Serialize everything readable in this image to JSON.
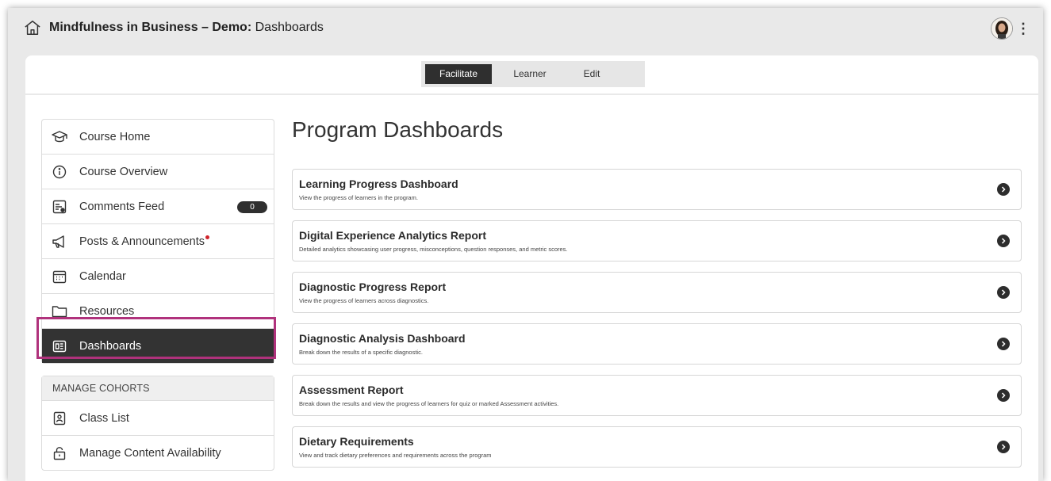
{
  "header": {
    "title_bold": "Mindfulness in Business – Demo:",
    "title_rest": "Dashboards",
    "icons": {
      "home": "home-icon",
      "avatar": "user-avatar",
      "menu": "kebab-menu-icon"
    }
  },
  "tabs": [
    {
      "label": "Facilitate",
      "active": true
    },
    {
      "label": "Learner",
      "active": false
    },
    {
      "label": "Edit",
      "active": false
    }
  ],
  "sidebar": {
    "items": [
      {
        "label": "Course Home",
        "icon": "graduation-cap-icon"
      },
      {
        "label": "Course Overview",
        "icon": "info-icon"
      },
      {
        "label": "Comments Feed",
        "icon": "comments-feed-icon",
        "badge": "0"
      },
      {
        "label": "Posts & Announcements",
        "icon": "megaphone-icon",
        "notification": true
      },
      {
        "label": "Calendar",
        "icon": "calendar-icon"
      },
      {
        "label": "Resources",
        "icon": "folder-icon"
      },
      {
        "label": "Dashboards",
        "icon": "dashboard-icon",
        "active": true
      }
    ],
    "cohorts": {
      "heading": "MANAGE COHORTS",
      "items": [
        {
          "label": "Class List",
          "icon": "class-list-icon"
        },
        {
          "label": "Manage Content Availability",
          "icon": "lock-icon"
        }
      ]
    }
  },
  "main": {
    "title": "Program Dashboards",
    "dashboards": [
      {
        "title": "Learning Progress Dashboard",
        "description": "View the progress of learners in the program."
      },
      {
        "title": "Digital Experience Analytics Report",
        "description": "Detailed analytics showcasing user progress, misconceptions, question responses, and metric scores."
      },
      {
        "title": "Diagnostic Progress Report",
        "description": "View the progress of learners across diagnostics."
      },
      {
        "title": "Diagnostic Analysis Dashboard",
        "description": "Break down the results of a specific diagnostic."
      },
      {
        "title": "Assessment Report",
        "description": "Break down the results and view the progress of learners for quiz or marked Assessment activities."
      },
      {
        "title": "Dietary Requirements",
        "description": "View and track dietary preferences and requirements across the program"
      }
    ]
  },
  "colors": {
    "accent": "#2f2f2f",
    "highlight_border": "#b0327c",
    "notification": "#d0242b",
    "frame_bg": "#e9e9e9"
  }
}
